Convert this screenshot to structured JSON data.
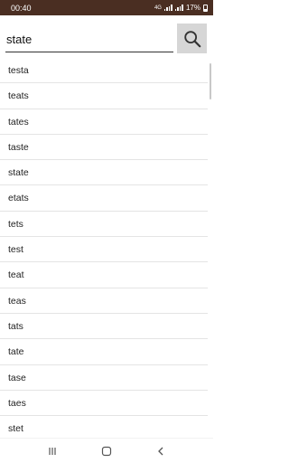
{
  "status_bar": {
    "time": "00:40",
    "network": "4G",
    "battery": "17%"
  },
  "search": {
    "value": "state",
    "button_icon": "search-icon"
  },
  "results": [
    "testa",
    "teats",
    "tates",
    "taste",
    "state",
    "etats",
    "tets",
    "test",
    "teat",
    "teas",
    "tats",
    "tate",
    "tase",
    "taes",
    "stet"
  ],
  "nav": {
    "recents_icon": "recents-icon",
    "home_icon": "home-icon",
    "back_icon": "back-icon"
  }
}
